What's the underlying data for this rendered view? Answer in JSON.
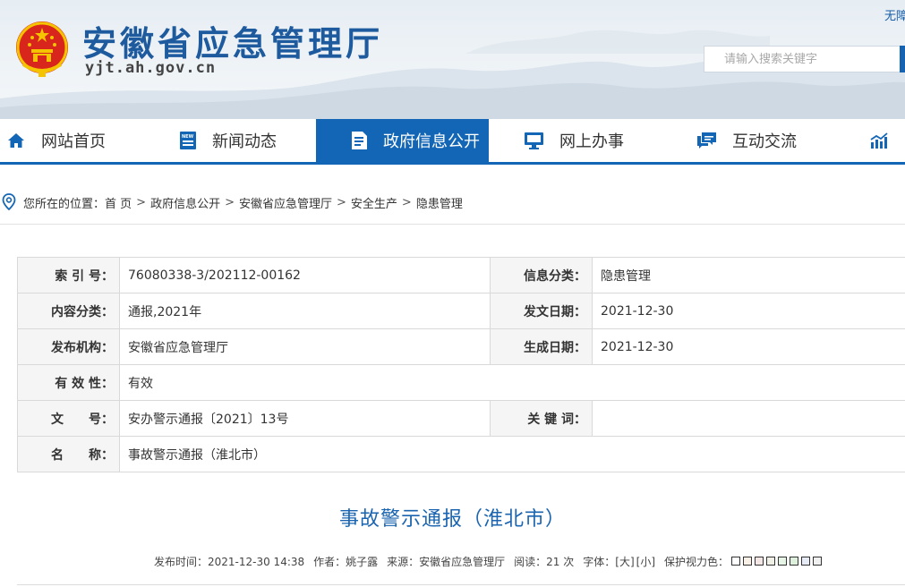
{
  "header": {
    "site_title": "安徽省应急管理厅",
    "site_domain": "yjt.ah.gov.cn",
    "top_link": "无障",
    "search_placeholder": "请输入搜索关键字"
  },
  "nav": {
    "items": [
      {
        "label": "网站首页",
        "icon": "home-icon"
      },
      {
        "label": "新闻动态",
        "icon": "news-icon"
      },
      {
        "label": "政府信息公开",
        "icon": "document-icon",
        "active": true
      },
      {
        "label": "网上办事",
        "icon": "monitor-icon"
      },
      {
        "label": "互动交流",
        "icon": "chat-icon"
      },
      {
        "label": "",
        "icon": "chart-icon"
      }
    ],
    "accent_color": "#1366b5"
  },
  "breadcrumb": {
    "prefix": "您所在的位置：",
    "items": [
      "首 页",
      "政府信息公开",
      "安徽省应急管理厅",
      "安全生产",
      "隐患管理"
    ],
    "separator": ">"
  },
  "meta": {
    "index_label": "索 引 号：",
    "index_value": "76080338-3/202112-00162",
    "category_label": "信息分类：",
    "category_value": "隐患管理",
    "content_label": "内容分类：",
    "content_value": "通报,2021年",
    "issue_date_label": "发文日期：",
    "issue_date_value": "2021-12-30",
    "publisher_label": "发布机构：",
    "publisher_value": "安徽省应急管理厅",
    "gen_date_label": "生成日期：",
    "gen_date_value": "2021-12-30",
    "validity_label": "有 效 性：",
    "validity_value": "有效",
    "docno_label": "文　　号：",
    "docno_value": "安办警示通报〔2021〕13号",
    "keywords_label": "关 键 词：",
    "keywords_value": "",
    "name_label": "名　　称：",
    "name_value": "事故警示通报（淮北市）"
  },
  "article": {
    "title": "事故警示通报（淮北市）",
    "publish_time": "发布时间：2021-12-30 14:38",
    "author": "作者：姚子露",
    "source": "来源：安徽省应急管理厅",
    "reads": "阅读：21 次",
    "font_label": "字体：",
    "font_large": "[大]",
    "font_small": "[小]",
    "eye_protect_label": "保护视力色：",
    "eye_colors": [
      "#ffffff",
      "#faf0e6",
      "#f5e6e6",
      "#f0f0e6",
      "#e6f5e6",
      "#dcf0dc",
      "#e6ebf5",
      "#f0f0f0"
    ]
  }
}
